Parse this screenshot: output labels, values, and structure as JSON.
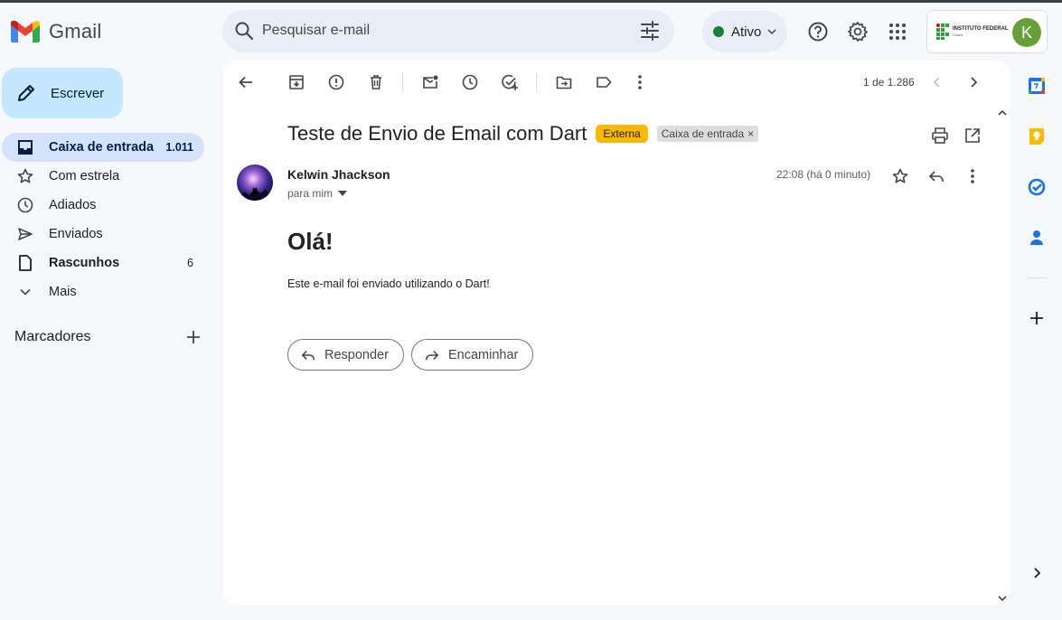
{
  "app": {
    "name": "Gmail"
  },
  "search": {
    "placeholder": "Pesquisar e-mail"
  },
  "status": {
    "label": "Ativo"
  },
  "account": {
    "org_name": "INSTITUTO FEDERAL",
    "org_sub": "Ceará",
    "initial": "K"
  },
  "sidebar": {
    "compose_label": "Escrever",
    "items": [
      {
        "label": "Caixa de entrada",
        "count": "1.011",
        "icon": "inbox-icon"
      },
      {
        "label": "Com estrela",
        "count": "",
        "icon": "star-icon"
      },
      {
        "label": "Adiados",
        "count": "",
        "icon": "clock-icon"
      },
      {
        "label": "Enviados",
        "count": "",
        "icon": "send-icon"
      },
      {
        "label": "Rascunhos",
        "count": "6",
        "icon": "draft-icon"
      },
      {
        "label": "Mais",
        "count": "",
        "icon": "chevron-down-icon"
      }
    ],
    "labels_title": "Marcadores"
  },
  "toolbar": {
    "pager": "1 de 1.286"
  },
  "email": {
    "subject": "Teste de Envio de Email com Dart",
    "badge_external": "Externa",
    "badge_inbox": "Caixa de entrada",
    "badge_inbox_close": "×",
    "sender": "Kelwin Jhackson",
    "to": "para mim",
    "time": "22:08 (há 0 minuto)",
    "heading": "Olá!",
    "body": "Este e-mail foi enviado utilizando o Dart!",
    "reply_label": "Responder",
    "forward_label": "Encaminhar"
  },
  "colors": {
    "accent": "#c2e7ff",
    "active_nav": "#d3e3fd",
    "external_badge": "#f9b804",
    "status_dot": "#188038",
    "avatar": "#689f38"
  }
}
